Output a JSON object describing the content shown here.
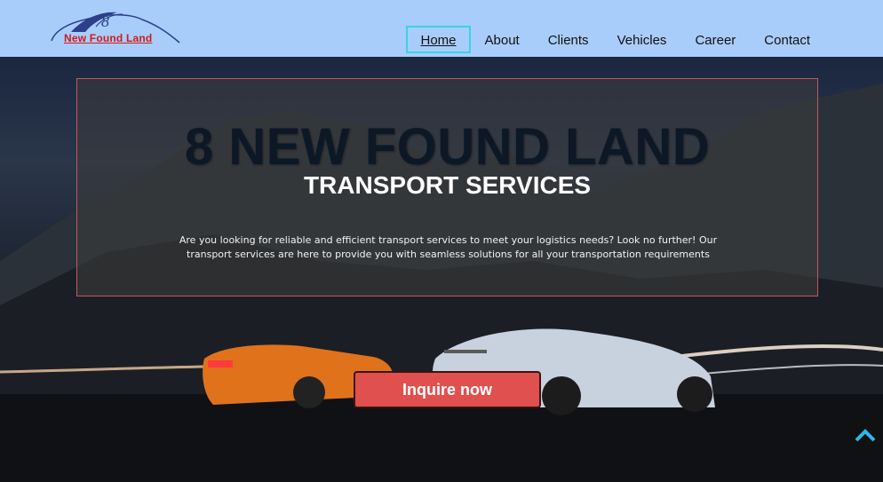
{
  "header": {
    "logo": {
      "text": "New Found Land",
      "numeral": "8"
    },
    "nav": [
      {
        "label": "Home",
        "active": true
      },
      {
        "label": "About"
      },
      {
        "label": "Clients"
      },
      {
        "label": "Vehicles"
      },
      {
        "label": "Career"
      },
      {
        "label": "Contact"
      }
    ]
  },
  "hero": {
    "title": "8 NEW FOUND LAND",
    "subtitle": "TRANSPORT SERVICES",
    "description": "Are you looking for reliable and efficient transport services to meet your logistics needs? Look no further! Our transport services are here to provide you with seamless solutions for all your transportation requirements",
    "cta_label": "Inquire now"
  },
  "icons": {
    "back_to_top": "chevron-up-icon"
  },
  "colors": {
    "header_bg": "#a9cdfb",
    "active_border": "#39d4e2",
    "cta_bg": "#e0504f",
    "logo_text": "#d11a1a",
    "back_to_top_arrow": "#2fb8e6"
  }
}
